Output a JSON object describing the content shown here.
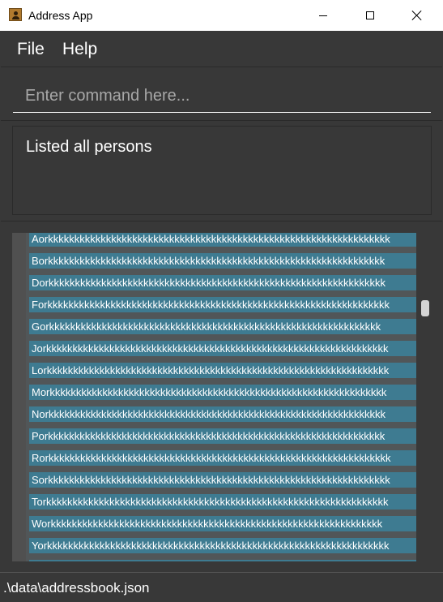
{
  "window": {
    "title": "Address App",
    "icon": "address-book-icon"
  },
  "menu": {
    "items": [
      {
        "label": "File"
      },
      {
        "label": "Help"
      }
    ]
  },
  "command": {
    "value": "",
    "placeholder": "Enter command here..."
  },
  "result": {
    "text": "Listed all persons"
  },
  "person_list": {
    "items": [
      {
        "name": "Aorkkkkkkkkkkkkkkkkkkkkkkkkkkkkkkkkkkkkkkkkkkkkkkkkkkkkkkkkkkkkkkkkk"
      },
      {
        "name": "Borkkkkkkkkkkkkkkkkkkkkkkkkkkkkkkkkkkkkkkkkkkkkkkkkkkkkkkkkkkkkkkkk"
      },
      {
        "name": "Dorkkkkkkkkkkkkkkkkkkkkkkkkkkkkkkkkkkkkkkkkkkkkkkkkkkkkkkkkkkkkkkkk"
      },
      {
        "name": "Forkkkkkkkkkkkkkkkkkkkkkkkkkkkkkkkkkkkkkkkkkkkkkkkkkkkkkkkkkkkkkkkkk"
      },
      {
        "name": "Gorkkkkkkkkkkkkkkkkkkkkkkkkkkkkkkkkkkkkkkkkkkkkkkkkkkkkkkkkkkkkkkk"
      },
      {
        "name": "Jorkkkkkkkkkkkkkkkkkkkkkkkkkkkkkkkkkkkkkkkkkkkkkkkkkkkkkkkkkkkkkkkkk"
      },
      {
        "name": "Lorkkkkkkkkkkkkkkkkkkkkkkkkkkkkkkkkkkkkkkkkkkkkkkkkkkkkkkkkkkkkkkkkk"
      },
      {
        "name": "Morkkkkkkkkkkkkkkkkkkkkkkkkkkkkkkkkkkkkkkkkkkkkkkkkkkkkkkkkkkkkkkkk"
      },
      {
        "name": "Norkkkkkkkkkkkkkkkkkkkkkkkkkkkkkkkkkkkkkkkkkkkkkkkkkkkkkkkkkkkkkkkk"
      },
      {
        "name": "Porkkkkkkkkkkkkkkkkkkkkkkkkkkkkkkkkkkkkkkkkkkkkkkkkkkkkkkkkkkkkkkkk"
      },
      {
        "name": "Rorkkkkkkkkkkkkkkkkkkkkkkkkkkkkkkkkkkkkkkkkkkkkkkkkkkkkkkkkkkkkkkkkk"
      },
      {
        "name": "Sorkkkkkkkkkkkkkkkkkkkkkkkkkkkkkkkkkkkkkkkkkkkkkkkkkkkkkkkkkkkkkkkkk"
      },
      {
        "name": "Torkkkkkkkkkkkkkkkkkkkkkkkkkkkkkkkkkkkkkkkkkkkkkkkkkkkkkkkkkkkkkkkkk"
      },
      {
        "name": "Workkkkkkkkkkkkkkkkkkkkkkkkkkkkkkkkkkkkkkkkkkkkkkkkkkkkkkkkkkkkkkk"
      },
      {
        "name": "Yorkkkkkkkkkkkkkkkkkkkkkkkkkkkkkkkkkkkkkkkkkkkkkkkkkkkkkkkkkkkkkkkkk"
      }
    ]
  },
  "status": {
    "save_location": ".\\data\\addressbook.json"
  },
  "colors": {
    "background": "#383838",
    "card": "#3e7b91",
    "row": "#515658",
    "text": "#ffffff"
  }
}
